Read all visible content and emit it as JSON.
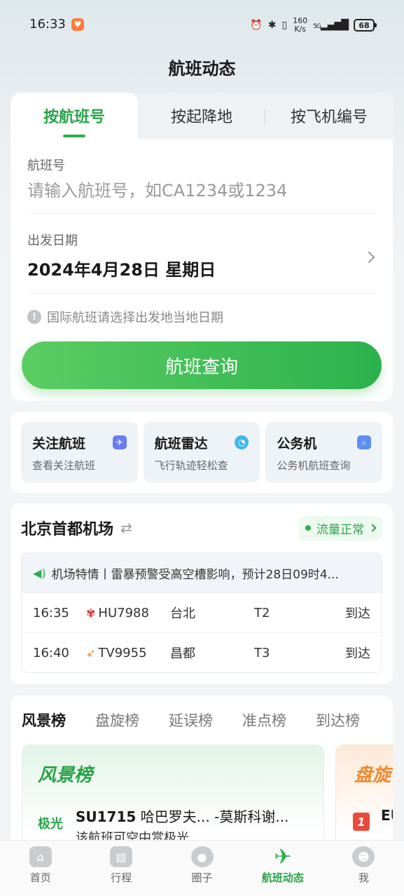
{
  "status_bar": {
    "time": "16:33",
    "net_speed_value": "160",
    "net_speed_unit": "K/s",
    "signal": "5G",
    "battery": "68"
  },
  "header": {
    "title": "航班动态"
  },
  "search": {
    "tabs": [
      {
        "label": "按航班号",
        "active": true
      },
      {
        "label": "按起降地",
        "active": false
      },
      {
        "label": "按飞机编号",
        "active": false
      }
    ],
    "flight_no_label": "航班号",
    "flight_no_placeholder": "请输入航班号，如CA1234或1234",
    "date_label": "出发日期",
    "date_value": "2024年4月28日 星期日",
    "notice": "国际航班请选择出发地当地日期",
    "query_button": "航班查询"
  },
  "shortcuts": [
    {
      "title": "关注航班",
      "subtitle": "查看关注航班",
      "icon": "plane-ticket-icon"
    },
    {
      "title": "航班雷达",
      "subtitle": "飞行轨迹轻松查",
      "icon": "radar-icon"
    },
    {
      "title": "公务机",
      "subtitle": "公务机航班查询",
      "icon": "business-jet-icon"
    }
  ],
  "airport": {
    "name": "北京首都机场",
    "flow_status": "流量正常",
    "alert": "机场特情丨雷暴预警受高空槽影响，预计28日09时4...",
    "flights": [
      {
        "time": "16:35",
        "flight": "HU7988",
        "city": "台北",
        "terminal": "T2",
        "status": "到达"
      },
      {
        "time": "16:40",
        "flight": "TV9955",
        "city": "昌都",
        "terminal": "T3",
        "status": "到达"
      }
    ]
  },
  "rankings": {
    "tabs": [
      "风景榜",
      "盘旋榜",
      "延误榜",
      "准点榜",
      "到达榜"
    ],
    "active_tab": "风景榜",
    "panel_title": "风景榜",
    "item_badge": "极光",
    "item_flight": "SU1715",
    "item_route": "哈巴罗夫...  -莫斯科谢...",
    "item_desc": "该航班可空中赏极光",
    "panel2_title": "盘旋",
    "panel2_rank": "1",
    "panel2_text": "EU"
  },
  "bottom_nav": [
    {
      "label": "首页",
      "active": false
    },
    {
      "label": "行程",
      "active": false
    },
    {
      "label": "圈子",
      "active": false
    },
    {
      "label": "航班动态",
      "active": true
    },
    {
      "label": "我",
      "active": false
    }
  ],
  "colors": {
    "accent": "#2bb04e",
    "alert_red": "#e84a3b",
    "orange": "#f08a2c"
  }
}
